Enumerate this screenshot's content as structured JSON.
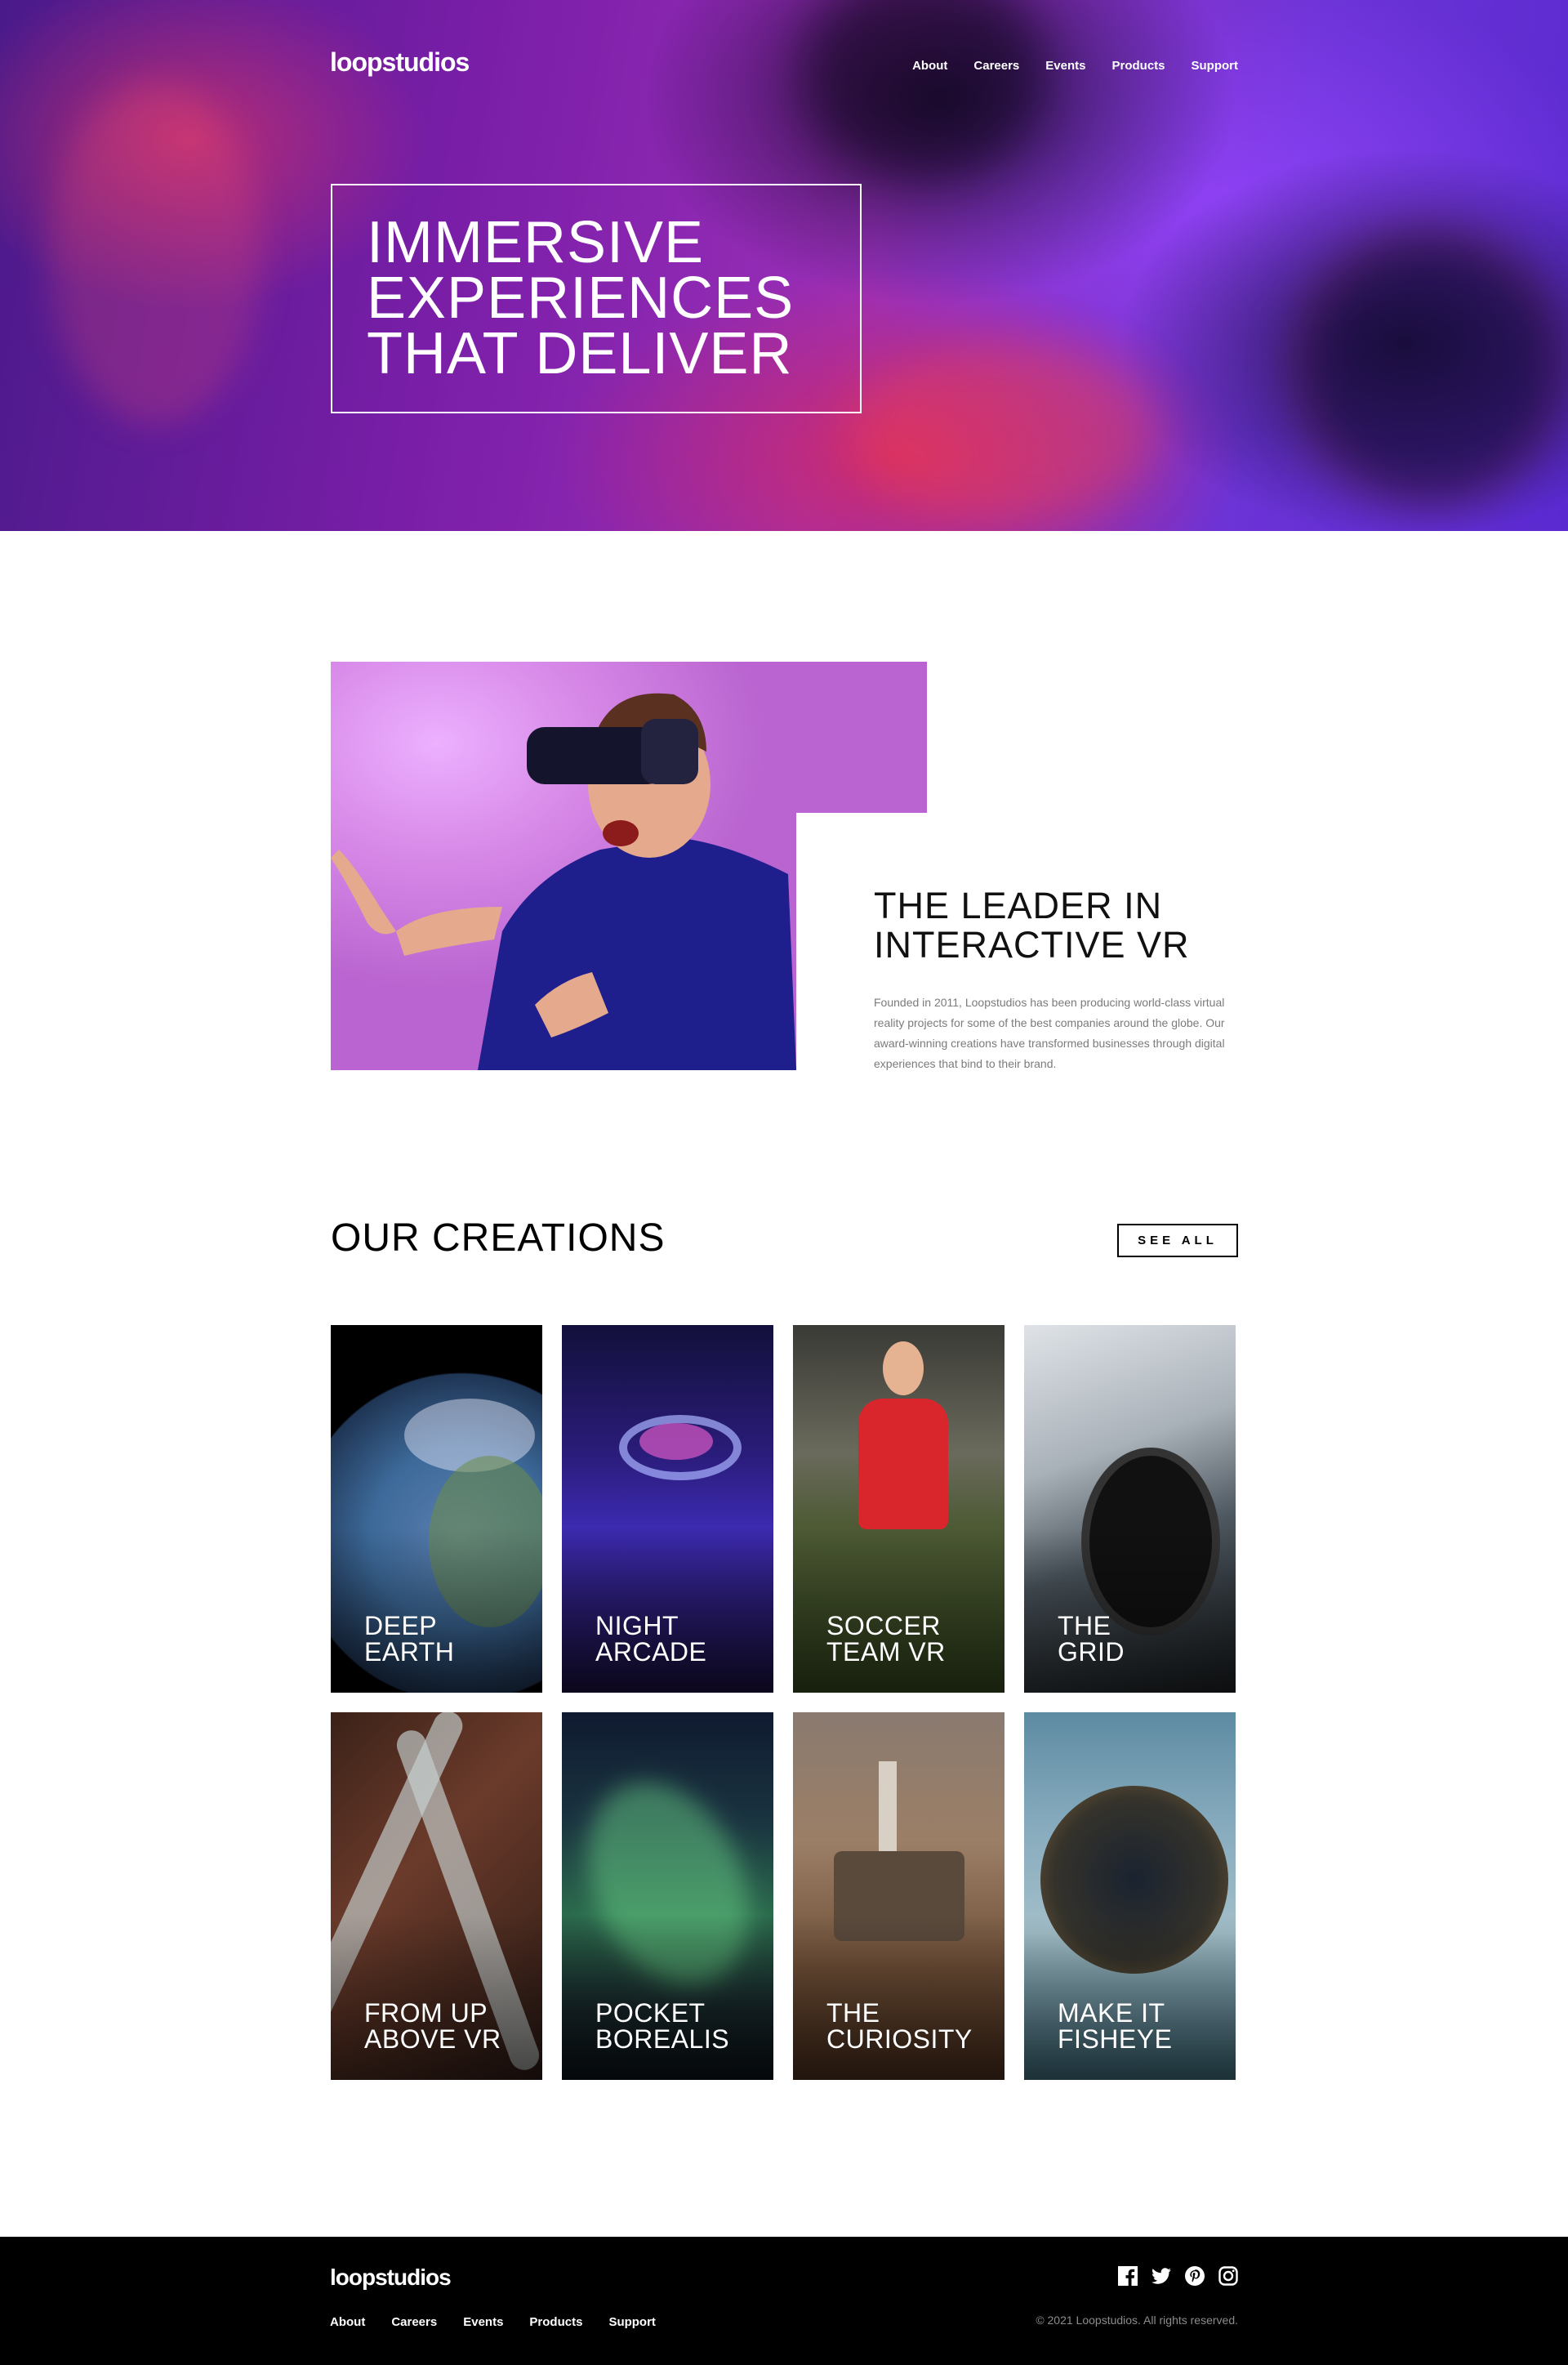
{
  "brand": {
    "logo": "loopstudios"
  },
  "nav": {
    "items": [
      "About",
      "Careers",
      "Events",
      "Products",
      "Support"
    ]
  },
  "hero": {
    "lines": [
      "IMMERSIVE",
      "EXPERIENCES",
      "THAT DELIVER"
    ]
  },
  "intro": {
    "title_lines": [
      "THE LEADER IN",
      "INTERACTIVE VR"
    ],
    "text": "Founded in 2011, Loopstudios has been producing world-class virtual reality projects for some of the best companies around the globe. Our award-winning creations have transformed businesses through digital experiences that bind to their brand."
  },
  "creations": {
    "title": "OUR CREATIONS",
    "see_all": "SEE ALL",
    "cards": [
      {
        "lines": [
          "DEEP",
          "EARTH"
        ]
      },
      {
        "lines": [
          "NIGHT",
          "ARCADE"
        ]
      },
      {
        "lines": [
          "SOCCER",
          "TEAM VR"
        ]
      },
      {
        "lines": [
          "THE",
          "GRID"
        ]
      },
      {
        "lines": [
          "FROM UP",
          "ABOVE VR"
        ]
      },
      {
        "lines": [
          "POCKET",
          "BOREALIS"
        ]
      },
      {
        "lines": [
          "THE",
          "CURIOSITY"
        ]
      },
      {
        "lines": [
          "MAKE IT",
          "FISHEYE"
        ]
      }
    ]
  },
  "footer": {
    "logo": "loopstudios",
    "nav": [
      "About",
      "Careers",
      "Events",
      "Products",
      "Support"
    ],
    "social_icons": [
      "facebook-icon",
      "twitter-icon",
      "pinterest-icon",
      "instagram-icon"
    ],
    "copyright": "© 2021 Loopstudios. All rights reserved."
  },
  "colors": {
    "hero_purple": "#7a1ea8",
    "footer_bg": "#000000",
    "text_gray": "#7b7b7b"
  }
}
